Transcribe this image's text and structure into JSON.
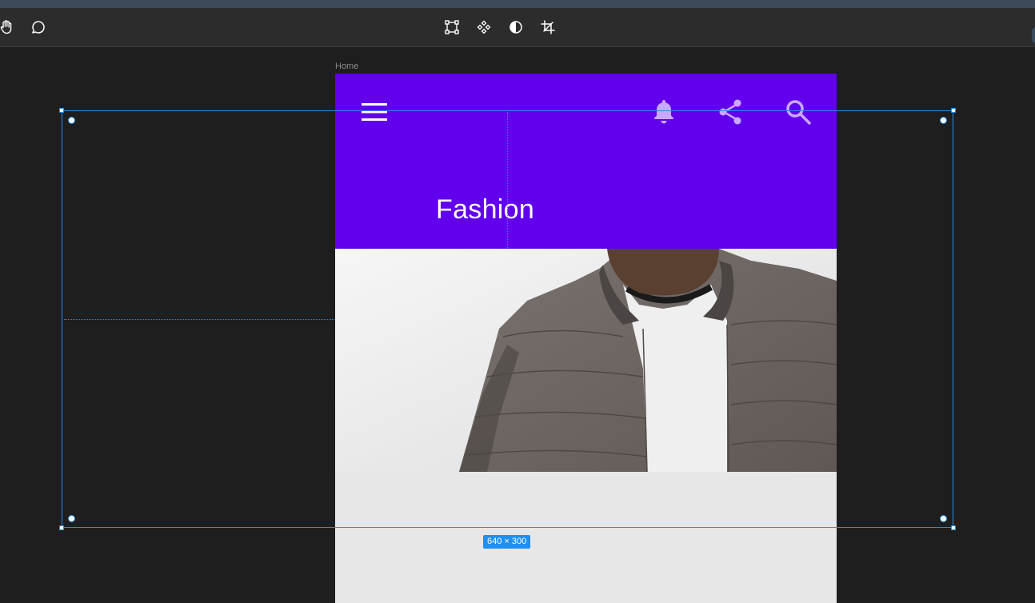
{
  "toolbar": {
    "tools_left": [
      "hand-icon",
      "comment-icon"
    ],
    "tools_center": [
      "frame-select-icon",
      "component-icon",
      "contrast-icon",
      "crop-icon"
    ]
  },
  "frame": {
    "label": "Home",
    "background": "#e7e7e7"
  },
  "app_bar": {
    "color": "#6200ee",
    "title": "Fashion",
    "icons": [
      "menu-icon",
      "bell-icon",
      "share-icon",
      "search-icon"
    ]
  },
  "hero_image": {
    "description_icon": "jacket-photo"
  },
  "selection": {
    "size_label": "640 × 300",
    "color": "#1f8ff0"
  }
}
